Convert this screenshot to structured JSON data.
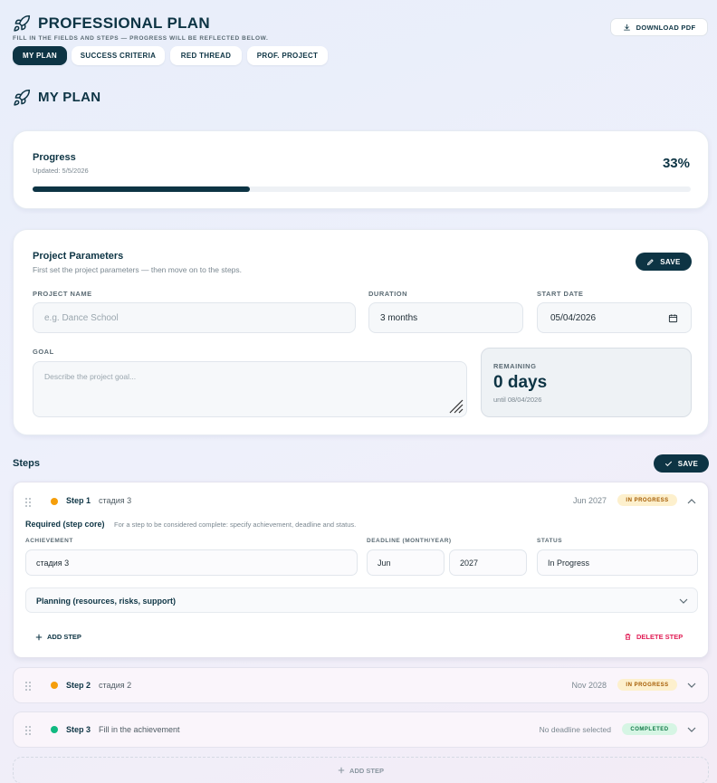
{
  "header": {
    "title": "PROFESSIONAL PLAN",
    "subtitle": "FILL IN THE FIELDS AND STEPS — PROGRESS WILL BE REFLECTED BELOW.",
    "download_label": "DOWNLOAD PDF",
    "tabs": [
      {
        "label": "MY PLAN",
        "active": true
      },
      {
        "label": "SUCCESS CRITERIA",
        "active": false
      },
      {
        "label": "RED THREAD",
        "active": false
      },
      {
        "label": "PROF. PROJECT",
        "active": false
      }
    ]
  },
  "section_title": "MY PLAN",
  "progress": {
    "title": "Progress",
    "updated": "Updated: 5/5/2026",
    "percent_label": "33%",
    "value": 0.33,
    "color": "#0d3444"
  },
  "params": {
    "title": "Project Parameters",
    "subtitle": "First set the project parameters — then move on to the steps.",
    "save_label": "SAVE",
    "project_name_label": "PROJECT NAME",
    "project_name_placeholder": "e.g. Dance School",
    "duration_label": "DURATION",
    "duration_value": "3 months",
    "start_date_label": "START DATE",
    "start_date_value": "05/04/2026",
    "goal_label": "GOAL",
    "goal_placeholder": "Describe the project goal...",
    "remaining_label": "REMAINING",
    "remaining_value": "0 days",
    "remaining_until": "until 08/04/2026"
  },
  "steps": {
    "title": "Steps",
    "save_label": "SAVE",
    "items": [
      {
        "name": "Step 1",
        "desc": "стадия 3",
        "deadline": "Jun 2027",
        "status_badge": "IN PROGRESS",
        "dot_color": "#f59e0b",
        "expanded": true
      },
      {
        "name": "Step 2",
        "desc": "стадия 2",
        "deadline": "Nov 2028",
        "status_badge": "IN PROGRESS",
        "dot_color": "#f59e0b",
        "expanded": false
      },
      {
        "name": "Step 3",
        "desc": "Fill in the achievement",
        "deadline": "No deadline selected",
        "status_badge": "COMPLETED",
        "dot_color": "#10b981",
        "expanded": false
      }
    ],
    "detail": {
      "required_title": "Required (step core)",
      "required_hint": "For a step to be considered complete: specify achievement, deadline and status.",
      "achievement_label": "ACHIEVEMENT",
      "achievement_value": "стадия 3",
      "deadline_label": "DEADLINE (MONTH/YEAR)",
      "deadline_month": "Jun",
      "deadline_year": "2027",
      "status_label": "STATUS",
      "status_value": "In Progress",
      "planning_label": "Planning (resources, risks, support)",
      "add_step_label": "ADD STEP",
      "delete_step_label": "DELETE STEP"
    },
    "add_step_bottom": "ADD STEP"
  }
}
